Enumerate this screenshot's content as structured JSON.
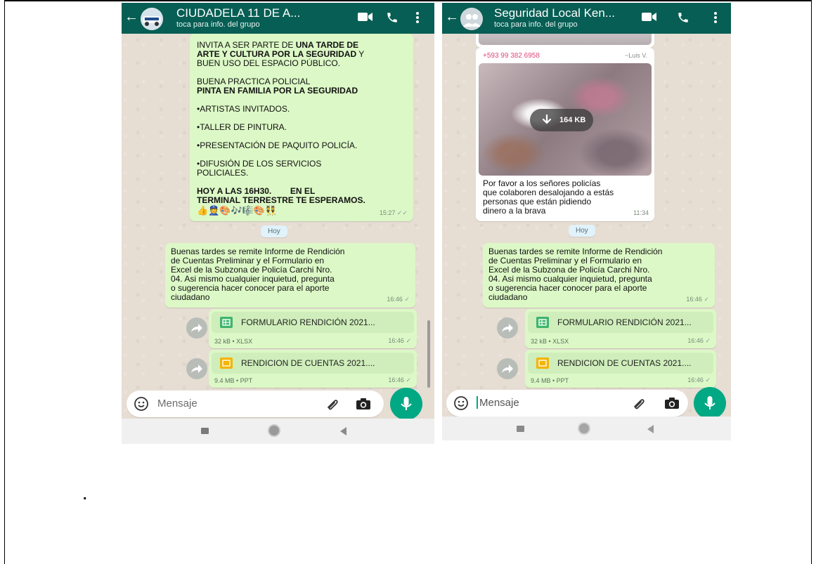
{
  "left_chat": {
    "header": {
      "title": "CIUDADELA 11 DE A...",
      "subtitle": "toca para info. del grupo"
    },
    "message1": {
      "line1a": "INVITA A SER PARTE DE ",
      "line1b": "UNA TARDE DE",
      "line2a": "ARTE Y CULTURA POR LA SEGURIDAD",
      "line2b": " Y",
      "line3": "BUEN USO DEL ESPACIO PÚBLICO.",
      "line4": "BUENA PRACTICA POLICIAL",
      "line5": "PINTA EN FAMILIA POR LA SEGURIDAD",
      "item1": "•ARTISTAS INVITADOS.",
      "item2": "•TALLER DE PINTURA.",
      "item3": "•PRESENTACIÓN DE PAQUITO POLICÍA.",
      "item4a": "•DIFUSIÓN DE LOS SERVICIOS",
      "item4b": "POLICIALES.",
      "line6": "HOY A LAS 16H30.        EN EL",
      "line7": "TERMINAL TERRESTRE TE ESPERAMOS.",
      "emojis": "👍👮🎨🎶🎼🎨👯",
      "time": "15:27"
    },
    "day_chip": "Hoy",
    "message2": {
      "lines": [
        "Buenas tardes se remite Informe de Rendición",
        "de Cuentas Preliminar y el Formulario en",
        "Excel de la Subzona de Policía Carchi Nro.",
        "04. Asi mismo cualquier inquietud, pregunta",
        "o sugerencia hacer conocer para el aporte",
        "ciudadano"
      ],
      "time": "16:46"
    },
    "doc1": {
      "name": "FORMULARIO RENDICIÓN 2021...",
      "meta": "32 kB • XLSX",
      "time": "16:46"
    },
    "doc2": {
      "name": "RENDICION DE CUENTAS 2021....",
      "meta": "9.4 MB • PPT",
      "time": "16:46"
    },
    "input_placeholder": "Mensaje"
  },
  "right_chat": {
    "header": {
      "title": "Seguridad  Local Ken...",
      "subtitle": "toca para info. del grupo"
    },
    "sender_phone": "+593 99 382 6958",
    "sender_name": "~Luis V.",
    "media_size": "164 KB",
    "caption": [
      "Por favor a los señores policías",
      "que colaboren desalojando a estás",
      "personas que están pidiendo",
      "dinero a la brava"
    ],
    "caption_time": "11:34",
    "day_chip": "Hoy",
    "message2": {
      "lines": [
        "Buenas tardes se remite Informe de Rendición",
        "de Cuentas Preliminar y el Formulario en",
        "Excel de la Subzona de Policía Carchi Nro.",
        "04. Asi mismo cualquier inquietud, pregunta",
        "o sugerencia hacer conocer para el aporte",
        "ciudadano"
      ],
      "time": "16:46"
    },
    "doc1": {
      "name": "FORMULARIO RENDICIÓN 2021...",
      "meta": "32 kB • XLSX",
      "time": "16:46"
    },
    "doc2": {
      "name": "RENDICION DE CUENTAS 2021....",
      "meta": "9.4 MB • PPT",
      "time": "16:46"
    },
    "input_placeholder": "Mensaje"
  },
  "page_mark": "."
}
